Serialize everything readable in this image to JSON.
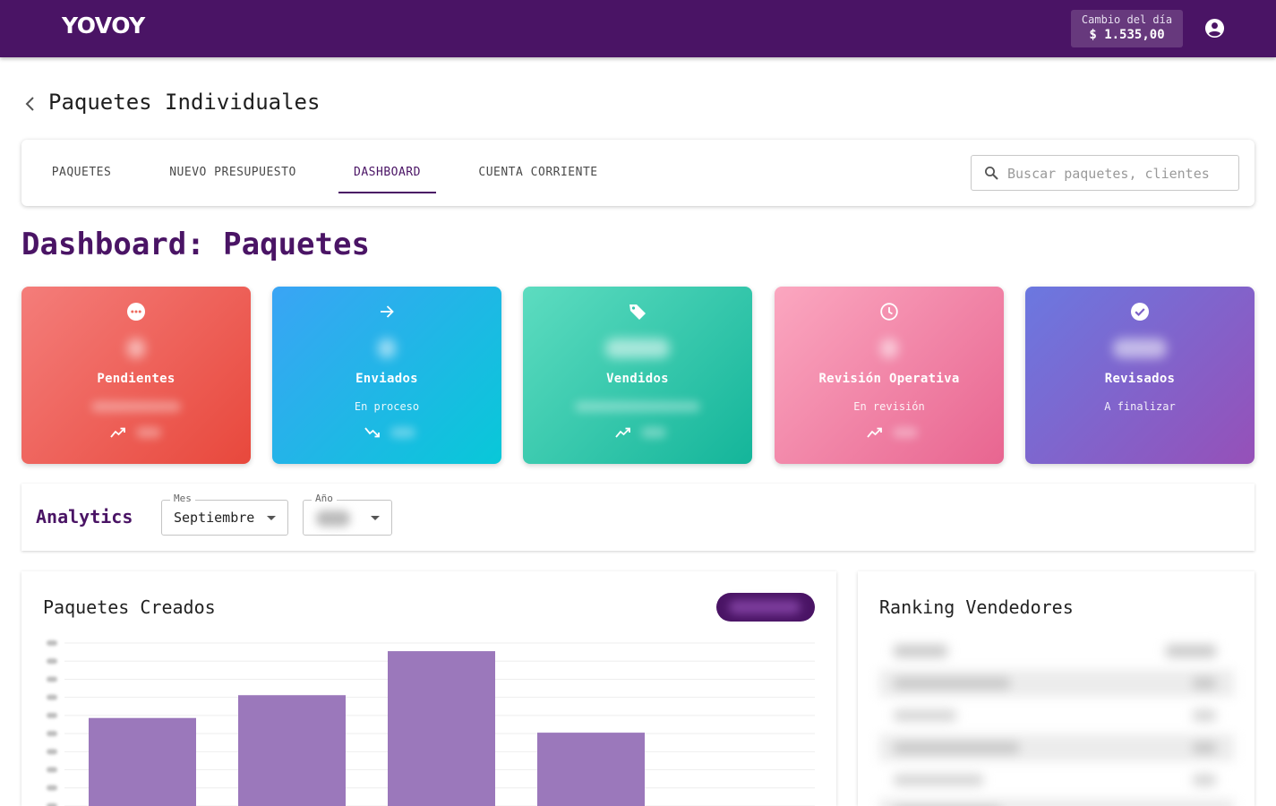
{
  "app": {
    "logo": "YOVOY",
    "rate_label": "Cambio del día",
    "rate_value": "$ 1.535,00"
  },
  "page": {
    "title": "Paquetes Individuales"
  },
  "tabs": [
    {
      "label": "PAQUETES",
      "active": false
    },
    {
      "label": "NUEVO PRESUPUESTO",
      "active": false
    },
    {
      "label": "DASHBOARD",
      "active": true
    },
    {
      "label": "CUENTA CORRIENTE",
      "active": false
    }
  ],
  "search": {
    "placeholder": "Buscar paquetes, clientes"
  },
  "dashboard": {
    "title": "Dashboard: Paquetes",
    "cards": [
      {
        "label": "Pendientes",
        "subtitle": "",
        "icon": "more-horizontal-icon",
        "trend": "trending-up-icon",
        "gradient": [
          "#f47d7a",
          "#e8483c"
        ]
      },
      {
        "label": "Enviados",
        "subtitle": "En proceso",
        "icon": "arrow-right-icon",
        "trend": "trending-down-icon",
        "gradient": [
          "#3aa4f5",
          "#08c8d8"
        ]
      },
      {
        "label": "Vendidos",
        "subtitle": "",
        "icon": "tag-icon",
        "trend": "trending-up-icon",
        "gradient": [
          "#5ddcc0",
          "#14b59a"
        ]
      },
      {
        "label": "Revisión Operativa",
        "subtitle": "En revisión",
        "icon": "clock-icon",
        "trend": "trending-up-icon",
        "gradient": [
          "#fba7c0",
          "#e86590"
        ]
      },
      {
        "label": "Revisados",
        "subtitle": "A finalizar",
        "icon": "check-circle-icon",
        "trend": "",
        "gradient": [
          "#6b78e0",
          "#9650b8"
        ]
      }
    ]
  },
  "analytics": {
    "title": "Analytics",
    "month_label": "Mes",
    "month_value": "Septiembre",
    "year_label": "Año"
  },
  "panels": {
    "created_title": "Paquetes Creados",
    "ranking_title": "Ranking Vendedores"
  },
  "colors": {
    "brand": "#4a1465",
    "bar": "#9b78bb"
  },
  "chart_data": {
    "type": "bar",
    "bar_fractions": [
      0.54,
      0.68,
      0.95,
      0.45
    ]
  }
}
